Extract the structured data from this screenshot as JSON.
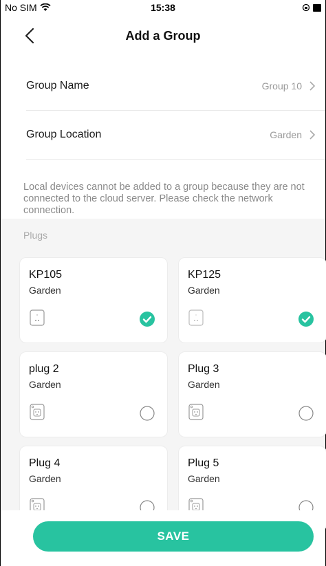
{
  "status_bar": {
    "carrier": "No SIM",
    "time": "15:38"
  },
  "header": {
    "title": "Add a Group"
  },
  "settings": {
    "group_name_label": "Group Name",
    "group_name_value": "Group 10",
    "group_location_label": "Group Location",
    "group_location_value": "Garden"
  },
  "notice": "Local devices cannot be added to a group because they are not connected to the cloud server. Please check the network connection.",
  "plugs_section": {
    "label": "Plugs",
    "items": [
      {
        "name": "KP105",
        "location": "Garden",
        "selected": true
      },
      {
        "name": "KP125",
        "location": "Garden",
        "selected": true
      },
      {
        "name": "plug 2",
        "location": "Garden",
        "selected": false
      },
      {
        "name": "Plug 3",
        "location": "Garden",
        "selected": false
      },
      {
        "name": "Plug 4",
        "location": "Garden",
        "selected": false
      },
      {
        "name": "Plug 5",
        "location": "Garden",
        "selected": false
      }
    ]
  },
  "save_button": {
    "label": "SAVE"
  },
  "colors": {
    "accent": "#28c3a0",
    "secondary_text": "#999999",
    "section_background": "#f5f5f5"
  }
}
